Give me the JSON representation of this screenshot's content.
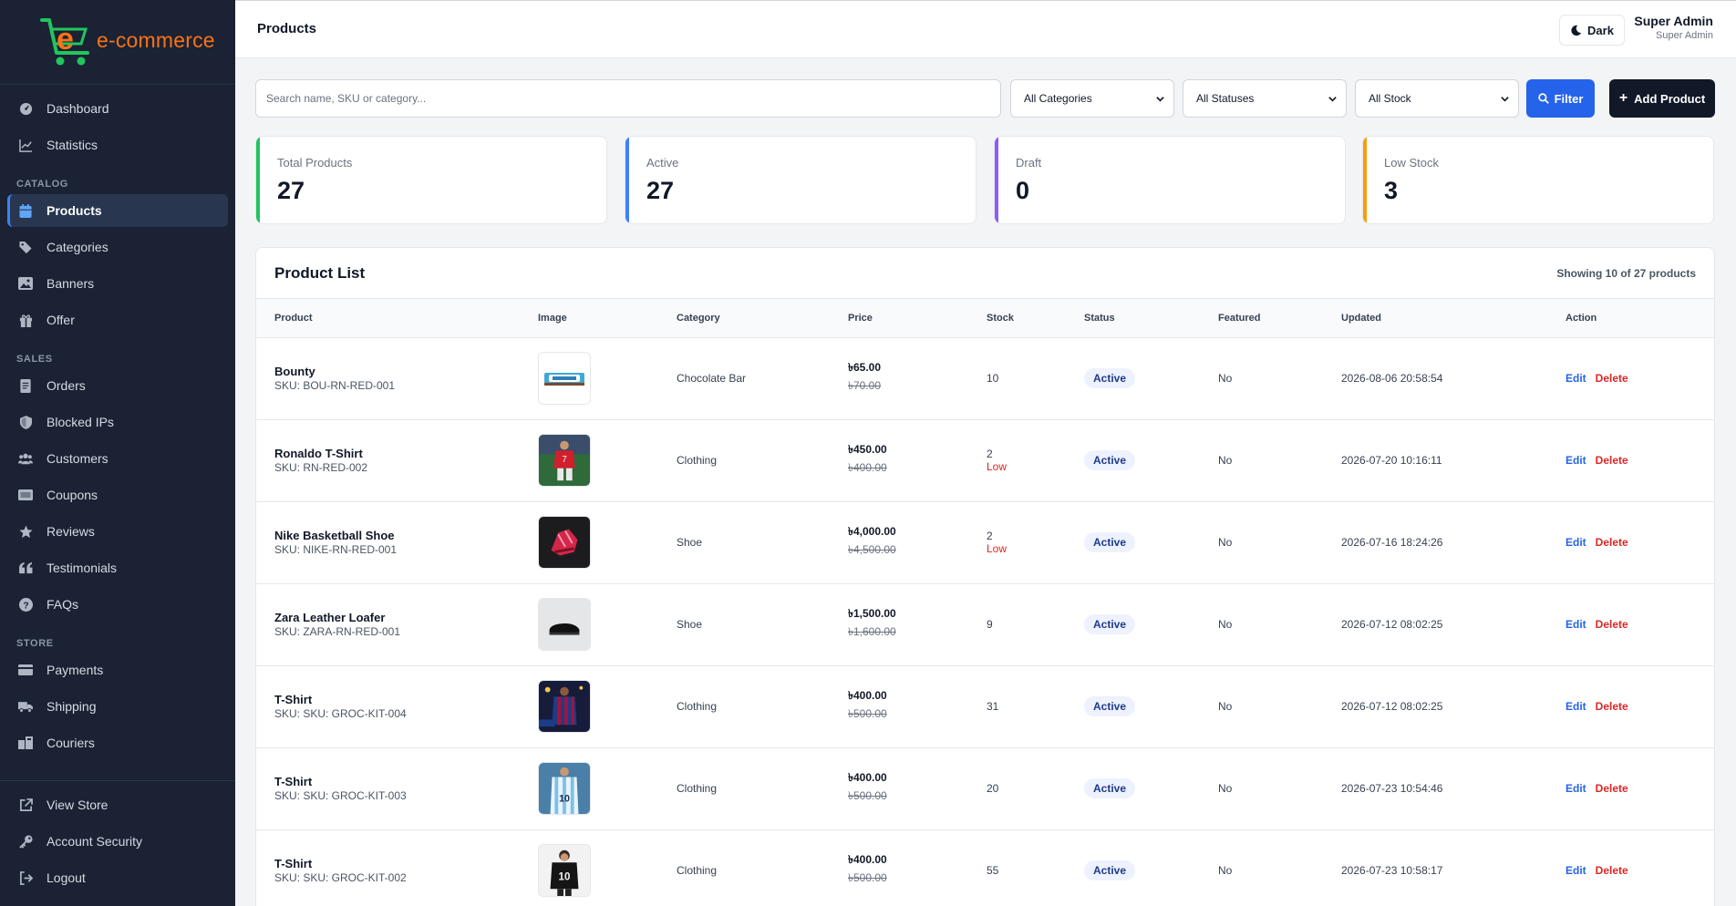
{
  "brand": {
    "logo_text": "e-commerce"
  },
  "sidebar": {
    "top_items": [
      {
        "label": "Dashboard",
        "icon": "gauge-icon"
      },
      {
        "label": "Statistics",
        "icon": "chart-line-icon"
      }
    ],
    "sections": [
      {
        "title": "CATALOG",
        "items": [
          {
            "label": "Products",
            "icon": "box-icon",
            "active": true
          },
          {
            "label": "Categories",
            "icon": "tags-icon"
          },
          {
            "label": "Banners",
            "icon": "image-icon"
          },
          {
            "label": "Offer",
            "icon": "gift-icon"
          }
        ]
      },
      {
        "title": "SALES",
        "items": [
          {
            "label": "Orders",
            "icon": "receipt-icon"
          },
          {
            "label": "Blocked IPs",
            "icon": "shield-icon"
          },
          {
            "label": "Customers",
            "icon": "users-icon"
          },
          {
            "label": "Coupons",
            "icon": "ticket-icon"
          },
          {
            "label": "Reviews",
            "icon": "star-icon"
          },
          {
            "label": "Testimonials",
            "icon": "quote-icon"
          },
          {
            "label": "FAQs",
            "icon": "question-icon"
          }
        ]
      },
      {
        "title": "STORE",
        "items": [
          {
            "label": "Payments",
            "icon": "credit-card-icon"
          },
          {
            "label": "Shipping",
            "icon": "truck-icon"
          },
          {
            "label": "Couriers",
            "icon": "couriers-icon"
          }
        ]
      }
    ],
    "bottom_items": [
      {
        "label": "View Store",
        "icon": "external-link-icon"
      },
      {
        "label": "Account Security",
        "icon": "key-icon"
      },
      {
        "label": "Logout",
        "icon": "logout-icon"
      }
    ]
  },
  "header": {
    "title": "Products",
    "theme_toggle": "Dark",
    "user_name": "Super Admin",
    "user_role": "Super Admin"
  },
  "filters": {
    "search_placeholder": "Search name, SKU or category...",
    "category": "All Categories",
    "status": "All Statuses",
    "stock": "All Stock",
    "filter_label": "Filter",
    "add_label": "Add Product"
  },
  "stats": [
    {
      "label": "Total Products",
      "value": "27",
      "color": "#22c55e"
    },
    {
      "label": "Active",
      "value": "27",
      "color": "#3b82f6"
    },
    {
      "label": "Draft",
      "value": "0",
      "color": "#8b5cf6"
    },
    {
      "label": "Low Stock",
      "value": "3",
      "color": "#f59e0b"
    }
  ],
  "product_list": {
    "title": "Product List",
    "count_text": "Showing 10 of 27 products",
    "columns": [
      "Product",
      "Image",
      "Category",
      "Price",
      "Stock",
      "Status",
      "Featured",
      "Updated",
      "Action"
    ],
    "edit_label": "Edit",
    "delete_label": "Delete",
    "rows": [
      {
        "name": "Bounty",
        "sku": "SKU: BOU-RN-RED-001",
        "image": "bounty-bar",
        "category": "Chocolate Bar",
        "price": "৳65.00",
        "old_price": "৳70.00",
        "stock": "10",
        "stock_note": "",
        "status": "Active",
        "featured": "No",
        "updated": "2026-08-06 20:58:54"
      },
      {
        "name": "Ronaldo T-Shirt",
        "sku": "SKU: RN-RED-002",
        "image": "ronaldo-shirt",
        "category": "Clothing",
        "price": "৳450.00",
        "old_price": "৳400.00",
        "stock": "2",
        "stock_note": "Low",
        "status": "Active",
        "featured": "No",
        "updated": "2026-07-20 10:16:11"
      },
      {
        "name": "Nike Basketball Shoe",
        "sku": "SKU: NIKE-RN-RED-001",
        "image": "nike-shoe",
        "category": "Shoe",
        "price": "৳4,000.00",
        "old_price": "৳4,500.00",
        "stock": "2",
        "stock_note": "Low",
        "status": "Active",
        "featured": "No",
        "updated": "2026-07-16 18:24:26"
      },
      {
        "name": "Zara Leather Loafer",
        "sku": "SKU: ZARA-RN-RED-001",
        "image": "loafer",
        "category": "Shoe",
        "price": "৳1,500.00",
        "old_price": "৳1,600.00",
        "stock": "9",
        "stock_note": "",
        "status": "Active",
        "featured": "No",
        "updated": "2026-07-12 08:02:25"
      },
      {
        "name": "T-Shirt",
        "sku": "SKU: SKU: GROC-KIT-004",
        "image": "barca-shirt",
        "category": "Clothing",
        "price": "৳400.00",
        "old_price": "৳500.00",
        "stock": "31",
        "stock_note": "",
        "status": "Active",
        "featured": "No",
        "updated": "2026-07-12 08:02:25"
      },
      {
        "name": "T-Shirt",
        "sku": "SKU: SKU: GROC-KIT-003",
        "image": "argentina-shirt",
        "category": "Clothing",
        "price": "৳400.00",
        "old_price": "৳500.00",
        "stock": "20",
        "stock_note": "",
        "status": "Active",
        "featured": "No",
        "updated": "2026-07-23 10:54:46"
      },
      {
        "name": "T-Shirt",
        "sku": "SKU: SKU: GROC-KIT-002",
        "image": "black-shirt",
        "category": "Clothing",
        "price": "৳400.00",
        "old_price": "৳500.00",
        "stock": "55",
        "stock_note": "",
        "status": "Active",
        "featured": "No",
        "updated": "2026-07-23 10:58:17"
      }
    ]
  }
}
